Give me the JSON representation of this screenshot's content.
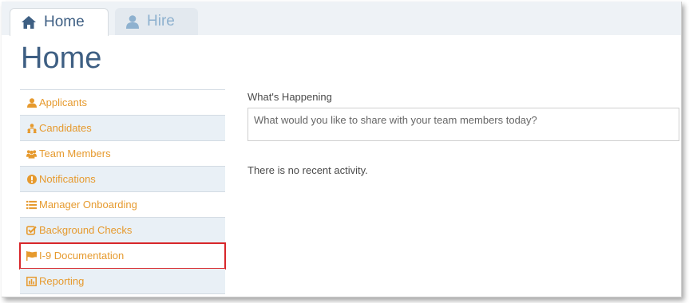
{
  "tabs": [
    {
      "label": "Home",
      "icon": "home-icon",
      "active": true
    },
    {
      "label": "Hire",
      "icon": "user-icon",
      "active": false
    }
  ],
  "page": {
    "title": "Home"
  },
  "sidebar": {
    "items": [
      {
        "label": "Applicants",
        "icon": "user-icon"
      },
      {
        "label": "Candidates",
        "icon": "org-chart-icon"
      },
      {
        "label": "Team Members",
        "icon": "users-icon"
      },
      {
        "label": "Notifications",
        "icon": "exclamation-circle-icon"
      },
      {
        "label": "Manager Onboarding",
        "icon": "list-icon"
      },
      {
        "label": "Background Checks",
        "icon": "check-square-icon"
      },
      {
        "label": "I-9 Documentation",
        "icon": "flag-icon",
        "highlighted": true
      },
      {
        "label": "Reporting",
        "icon": "bar-chart-icon"
      }
    ]
  },
  "main": {
    "section_label": "What's Happening",
    "share_placeholder": "What would you like to share with your team members today?",
    "empty_message": "There is no recent activity."
  },
  "colors": {
    "title_blue": "#3e5f83",
    "link_orange": "#e69a2e",
    "highlight_red": "#d8262a",
    "row_alt": "#e9f0f6"
  }
}
